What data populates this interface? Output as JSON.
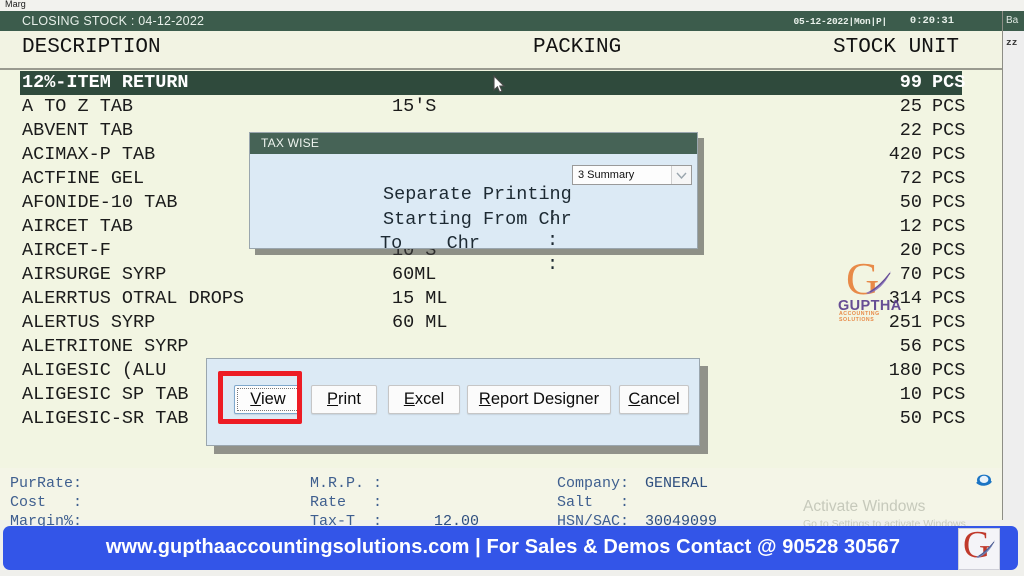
{
  "os_window": {
    "title": "Marg"
  },
  "header": {
    "title": "CLOSING STOCK : 04-12-2022",
    "date": "05-12-2022|Mon|P|",
    "clock": "0:20:31"
  },
  "columns": {
    "description": "DESCRIPTION",
    "packing": "PACKING",
    "stock_unit": "STOCK UNIT"
  },
  "rows": [
    {
      "description": "12%-ITEM RETURN",
      "packing": "",
      "stock": "99",
      "unit": "PCS",
      "selected": true
    },
    {
      "description": "A TO Z TAB",
      "packing": "15'S",
      "stock": "25",
      "unit": "PCS",
      "selected": false
    },
    {
      "description": "ABVENT TAB",
      "packing": "",
      "stock": "22",
      "unit": "PCS",
      "selected": false
    },
    {
      "description": "ACIMAX-P TAB",
      "packing": "",
      "stock": "420",
      "unit": "PCS",
      "selected": false
    },
    {
      "description": "ACTFINE GEL",
      "packing": "",
      "stock": "72",
      "unit": "PCS",
      "selected": false
    },
    {
      "description": "AFONIDE-10 TAB",
      "packing": "",
      "stock": "50",
      "unit": "PCS",
      "selected": false
    },
    {
      "description": "AIRCET TAB",
      "packing": "",
      "stock": "12",
      "unit": "PCS",
      "selected": false
    },
    {
      "description": "AIRCET-F",
      "packing": "10'S",
      "stock": "20",
      "unit": "PCS",
      "selected": false
    },
    {
      "description": "AIRSURGE SYRP",
      "packing": "60ML",
      "stock": "70",
      "unit": "PCS",
      "selected": false
    },
    {
      "description": "ALERRTUS OTRAL DROPS",
      "packing": "15 ML",
      "stock": "314",
      "unit": "PCS",
      "selected": false
    },
    {
      "description": "ALERTUS SYRP",
      "packing": "60 ML",
      "stock": "251",
      "unit": "PCS",
      "selected": false
    },
    {
      "description": "ALETRITONE SYRP",
      "packing": "",
      "stock": "56",
      "unit": "PCS",
      "selected": false
    },
    {
      "description": "ALIGESIC (ALU",
      "packing": "",
      "stock": "180",
      "unit": "PCS",
      "selected": false
    },
    {
      "description": "ALIGESIC SP TAB",
      "packing": "",
      "stock": "10",
      "unit": "PCS",
      "selected": false
    },
    {
      "description": "ALIGESIC-SR TAB",
      "packing": "",
      "stock": "50",
      "unit": "PCS",
      "selected": false
    }
  ],
  "watermark_logo": {
    "name": "GUPTHA",
    "subtitle": "ACCOUNTING SOLUTIONS"
  },
  "tax_wise_dialog": {
    "title": "TAX WISE",
    "separate_printing_label": "Separate Printing",
    "starting_from_chr_label": "Starting From Chr",
    "to_chr_label": "To    Chr",
    "colon": ":",
    "separate_printing_value": "3 Summary",
    "starting_from_chr_value": "",
    "to_chr_value": ""
  },
  "action_dialog": {
    "buttons": [
      {
        "id": "view",
        "accel": "V",
        "rest": "iew",
        "focused": true
      },
      {
        "id": "print",
        "accel": "P",
        "rest": "rint",
        "focused": false
      },
      {
        "id": "excel",
        "accel": "E",
        "rest": "xcel",
        "focused": false
      },
      {
        "id": "report",
        "accel": "R",
        "rest": "eport Designer",
        "focused": false
      },
      {
        "id": "cancel",
        "accel": "C",
        "rest": "ancel",
        "focused": false
      }
    ]
  },
  "info_panel": {
    "pur_rate_label": "PurRate:",
    "pur_rate_value": "",
    "cost_label": "Cost   :",
    "cost_value": "",
    "margin_label": "Margin%:",
    "margin_value": "",
    "mrp_label": "M.R.P. :",
    "mrp_value": "",
    "rate_label": "Rate   :",
    "rate_value": "",
    "tax_label": "Tax-T  :",
    "tax_value": "12.00",
    "company_label": "Company:",
    "company_value": "GENERAL",
    "salt_label": "Salt   :",
    "salt_value": "",
    "hsn_label": "HSN/SAC:",
    "hsn_value": "30049099"
  },
  "right_panel": {
    "header": "Ba",
    "text": "zz"
  },
  "activate_windows": {
    "line1": "Activate Windows",
    "line2": "Go to Settings to activate Windows."
  },
  "banner": {
    "text": "www.gupthaaccountingsolutions.com | For Sales & Demos Contact @ 90528 30567"
  },
  "colors": {
    "header_green": "#3c5c4c",
    "list_bg": "#f2f5e2",
    "dialog_blue": "#dceaf5",
    "banner_blue": "#3355e8",
    "highlight_red": "#ed1c24"
  }
}
